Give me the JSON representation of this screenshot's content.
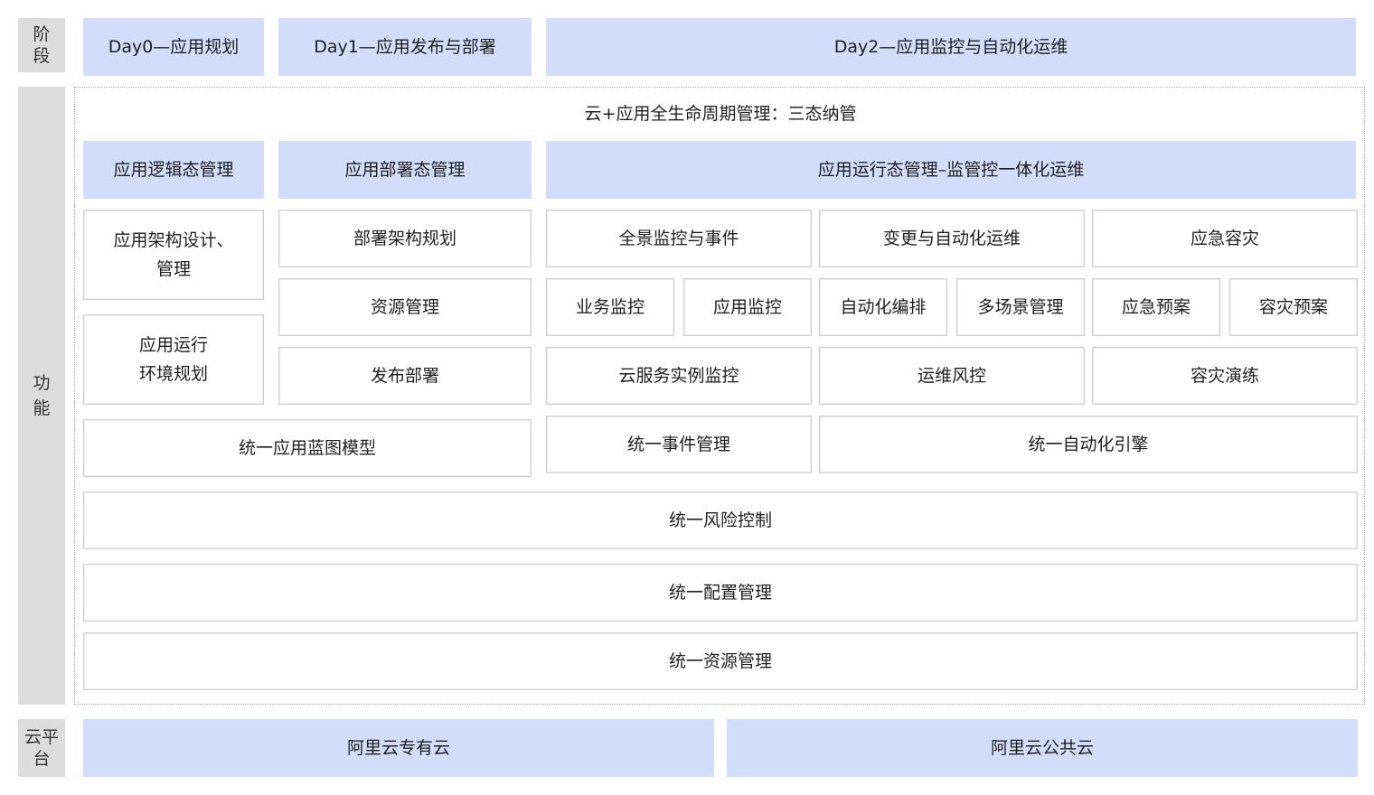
{
  "side_labels": {
    "stage": "阶\n段",
    "function": "功\n能",
    "platform": "云平\n台"
  },
  "stages": {
    "day0": "Day0—应用规划",
    "day1": "Day1—应用发布与部署",
    "day2": "Day2—应用监控与自动化运维"
  },
  "function_area": {
    "title": "云+应用全生命周期管理：三态纳管",
    "headers": {
      "logical": "应用逻辑态管理",
      "deploy": "应用部署态管理",
      "runtime": "应用运行态管理–监管控一体化运维"
    },
    "logical_items": {
      "arch_design_line1": "应用架构设计、",
      "arch_design_line2": "管理",
      "runtime_env_line1": "应用运行",
      "runtime_env_line2": "环境规划"
    },
    "deploy_items": {
      "arch_planning": "部署架构规划",
      "resource_mgmt": "资源管理",
      "release_deploy": "发布部署"
    },
    "runtime_groups": {
      "monitoring": "全景监控与事件",
      "change_ops": "变更与自动化运维",
      "disaster": "应急容灾"
    },
    "runtime_items": {
      "business_monitor": "业务监控",
      "app_monitor": "应用监控",
      "auto_orchestration": "自动化编排",
      "multi_scene": "多场景管理",
      "emergency_plan": "应急预案",
      "dr_plan": "容灾预案",
      "cloud_instance_monitor": "云服务实例监控",
      "ops_risk_control": "运维风控",
      "dr_drill": "容灾演练"
    },
    "unified": {
      "blueprint": "统一应用蓝图模型",
      "event_mgmt": "统一事件管理",
      "automation_engine": "统一自动化引擎",
      "risk_control": "统一风险控制",
      "config_mgmt": "统一配置管理",
      "resource_mgmt": "统一资源管理"
    }
  },
  "platforms": {
    "private_cloud": "阿里云专有云",
    "public_cloud": "阿里云公共云"
  },
  "colors": {
    "header_fill": "#d2dcfb",
    "side_fill": "#dcdcdc",
    "cell_border": "#cfcfcf"
  }
}
